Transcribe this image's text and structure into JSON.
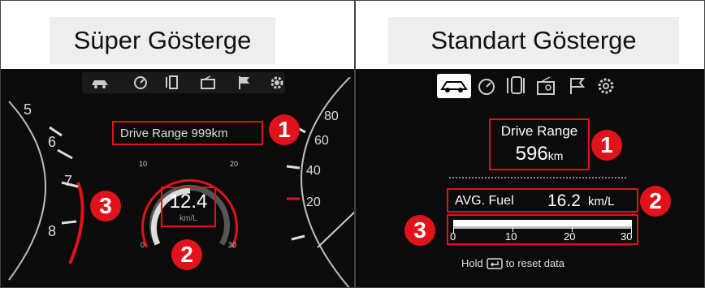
{
  "left": {
    "title": "Süper Gösterge",
    "drive_range": "Drive Range 999km",
    "fuel_value": "12.4",
    "fuel_unit": "km/L",
    "gauge_left_ticks": [
      "10",
      "20",
      "0",
      "30"
    ],
    "tach_ticks": [
      "5",
      "6",
      "7",
      "8"
    ],
    "speed_ticks": [
      "80",
      "60",
      "40",
      "20"
    ],
    "badges": [
      "1",
      "2",
      "3"
    ],
    "icons": [
      "car-icon",
      "speedometer-icon",
      "door-icon",
      "radio-icon",
      "flag-icon",
      "gear-icon"
    ]
  },
  "right": {
    "title": "Standart Gösterge",
    "drive_range_label": "Drive Range",
    "drive_range_value": "596",
    "drive_range_unit": "km",
    "avg_label": "AVG. Fuel",
    "avg_value": "16.2",
    "avg_unit": "km/L",
    "bar_ticks": [
      "0",
      "10",
      "20",
      "30"
    ],
    "hold_text_1": "Hold",
    "hold_text_2": "to reset data",
    "badges": [
      "1",
      "2",
      "3"
    ],
    "icons": [
      "car-icon",
      "speedometer-icon",
      "door-icon",
      "radio-icon",
      "flag-icon",
      "gear-icon"
    ]
  }
}
